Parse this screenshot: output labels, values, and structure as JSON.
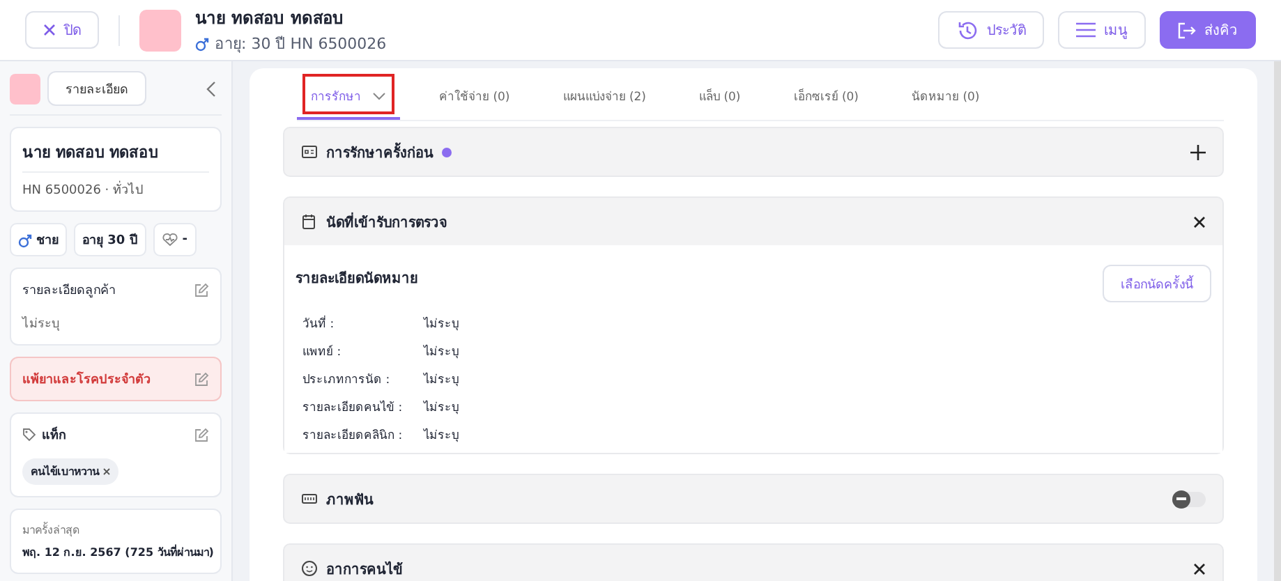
{
  "header": {
    "close_button": "ปิด",
    "patient_name": "นาย ทดสอบ ทดสอบ",
    "patient_info": "อายุ: 30 ปี HN 6500026",
    "buttons": [
      {
        "kind": "history",
        "label": "ประวัติ"
      },
      {
        "kind": "menu",
        "label": "เมนู"
      },
      {
        "kind": "send",
        "label": "ส่งคิว"
      }
    ]
  },
  "sidebar": {
    "details_button": "รายละเอียด",
    "name": "นาย ทดสอบ ทดสอบ",
    "hn": "HN 6500026 · ทั่วไป",
    "chips": [
      {
        "kind": "gender",
        "label": "ชาย"
      },
      {
        "kind": "age",
        "label": "อายุ 30 ปี"
      },
      {
        "kind": "heart",
        "label": "-"
      }
    ],
    "cards": [
      {
        "kind": "details",
        "title": "รายละเอียดลูกค้า",
        "value": "ไม่ระบุ"
      },
      {
        "kind": "alert",
        "title": "แพ้ยาและโรคประจำตัว"
      },
      {
        "kind": "tags",
        "title": "แท็ก",
        "tags": [
          "คนไข้เบาหวาน"
        ]
      },
      {
        "kind": "last_visit",
        "title": "มาครั้งล่าสุด",
        "value": "พฤ. 12 ก.ย. 2567 (725 วันที่ผ่านมา)"
      }
    ]
  },
  "tabs": [
    {
      "label": "การรักษา",
      "selected": true,
      "highlighted": true,
      "dropdown": true
    },
    {
      "label": "ค่าใช้จ่าย (0)",
      "selected": false,
      "highlighted": false,
      "dropdown": false
    },
    {
      "label": "แผนแบ่งจ่าย (2)",
      "selected": false,
      "highlighted": false,
      "dropdown": false
    },
    {
      "label": "แล็บ (0)",
      "selected": false,
      "highlighted": false,
      "dropdown": false
    },
    {
      "label": "เอ็กซเรย์ (0)",
      "selected": false,
      "highlighted": false,
      "dropdown": false
    },
    {
      "label": "นัดหมาย (0)",
      "selected": false,
      "highlighted": false,
      "dropdown": false
    }
  ],
  "sections": [
    {
      "kind": "previous",
      "title": "การรักษาครั้งก่อน",
      "color": "#8b6cf0"
    },
    {
      "kind": "appointment",
      "title": "นัดที่เข้ารับการตรวจ",
      "body_title": "รายละเอียดนัดหมาย",
      "body_button": "เลือกนัดครั้งนี้",
      "fields": [
        {
          "label": "วันที่ :",
          "value": "ไม่ระบุ"
        },
        {
          "label": "แพทย์ :",
          "value": "ไม่ระบุ"
        },
        {
          "label": "ประเภทการนัด :",
          "value": "ไม่ระบุ"
        },
        {
          "label": "รายละเอียดคนไข้ :",
          "value": "ไม่ระบุ"
        },
        {
          "label": "รายละเอียดคลินิก :",
          "value": "ไม่ระบุ"
        }
      ]
    },
    {
      "kind": "teeth",
      "title": "ภาพฟัน",
      "on": false
    },
    {
      "kind": "symptoms",
      "title": "อาการคนไข้"
    }
  ]
}
